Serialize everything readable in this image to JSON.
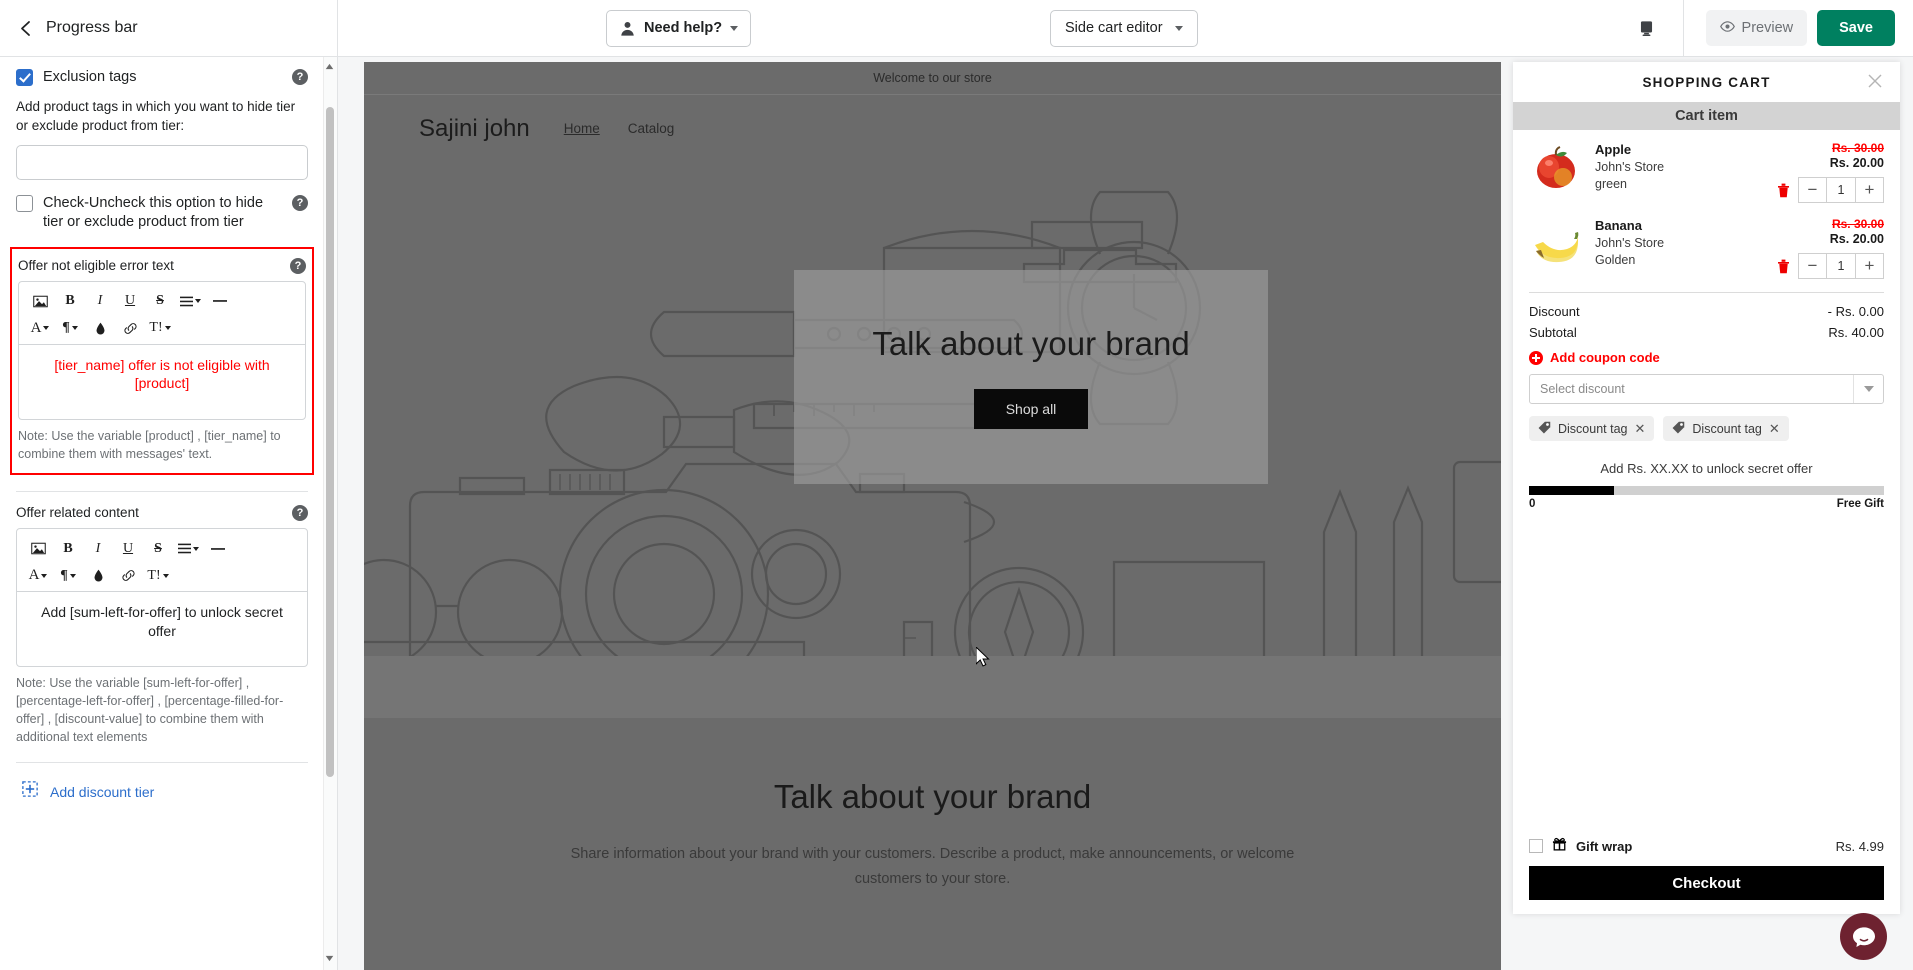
{
  "topbar": {
    "back_icon": "chevron-left-icon",
    "page_title": "Progress bar",
    "need_help_label": "Need help?",
    "need_help_icon": "person-icon",
    "editor_select_label": "Side cart editor",
    "device_icon": "desktop-icon",
    "preview_label": "Preview",
    "preview_icon": "eye-icon",
    "save_label": "Save"
  },
  "left_panel": {
    "exclusion_tags": {
      "label": "Exclusion tags",
      "checked": true,
      "help_icon": "help-icon",
      "description": "Add product tags in which you want to hide tier or exclude product from tier:",
      "input_value": "",
      "input_placeholder": ""
    },
    "hide_tier_checkbox": {
      "label": "Check-Uncheck this option to hide tier or exclude product from tier",
      "checked": false,
      "help_icon": "help-icon"
    },
    "error_text_section": {
      "title": "Offer not eligible error text",
      "help_icon": "help-icon",
      "content": "[tier_name] offer is not eligible with [product]",
      "note": "Note: Use the variable [product] , [tier_name] to combine them with messages' text.",
      "toolbar": [
        {
          "icon": "image-icon",
          "label": "☐"
        },
        {
          "icon": "bold-icon",
          "label": "B"
        },
        {
          "icon": "italic-icon",
          "label": "I"
        },
        {
          "icon": "underline-icon",
          "label": "U"
        },
        {
          "icon": "strikethrough-icon",
          "label": "S"
        },
        {
          "icon": "align-icon",
          "label": "≡"
        },
        {
          "icon": "horizontal-rule-icon",
          "label": "—"
        },
        {
          "icon": "font-color-icon",
          "label": "A"
        },
        {
          "icon": "paragraph-icon",
          "label": "¶"
        },
        {
          "icon": "highlight-icon",
          "label": "◆"
        },
        {
          "icon": "link-icon",
          "label": "⚭"
        },
        {
          "icon": "clear-format-icon",
          "label": "T!"
        }
      ]
    },
    "related_content_section": {
      "title": "Offer related content",
      "help_icon": "help-icon",
      "content": "Add [sum-left-for-offer] to unlock secret offer",
      "note": "Note: Use the variable [sum-left-for-offer] , [percentage-left-for-offer] , [percentage-filled-for-offer] , [discount-value] to combine them with additional text elements"
    },
    "add_tier": {
      "label": "Add discount tier",
      "icon": "add-square-icon"
    }
  },
  "store_preview": {
    "announcement": "Welcome to our store",
    "brand": "Sajini john",
    "nav": [
      {
        "label": "Home",
        "active": true
      },
      {
        "label": "Catalog",
        "active": false
      }
    ],
    "hero": {
      "title": "Talk about your brand",
      "button": "Shop all"
    },
    "rich_text": {
      "title": "Talk about your brand",
      "body": "Share information about your brand with your customers. Describe a product, make announcements, or welcome customers to your store."
    }
  },
  "cart": {
    "title": "SHOPPING CART",
    "close_icon": "close-icon",
    "section_label": "Cart item",
    "items": [
      {
        "name": "Apple",
        "store": "John's Store",
        "variant": "green",
        "price_old": "Rs. 30.00",
        "price_new": "Rs. 20.00",
        "qty": "1",
        "thumb": "apple-image",
        "delete_icon": "trash-icon"
      },
      {
        "name": "Banana",
        "store": "John's Store",
        "variant": "Golden",
        "price_old": "Rs. 30.00",
        "price_new": "Rs. 20.00",
        "qty": "1",
        "thumb": "banana-image",
        "delete_icon": "trash-icon"
      }
    ],
    "discount_label": "Discount",
    "discount_value": "- Rs. 0.00",
    "subtotal_label": "Subtotal",
    "subtotal_value": "Rs. 40.00",
    "coupon_label": "Add coupon code",
    "select_discount_placeholder": "Select discount",
    "tags": [
      {
        "label": "Discount tag"
      },
      {
        "label": "Discount tag"
      }
    ],
    "progress": {
      "text": "Add Rs. XX.XX to unlock secret offer",
      "start_label": "0",
      "end_label": "Free Gift",
      "percent": 24
    },
    "gift_wrap": {
      "label": "Gift wrap",
      "price": "Rs. 4.99",
      "icon": "gift-icon",
      "checked": false
    },
    "checkout_label": "Checkout",
    "chat_icon": "chat-bubble-icon"
  },
  "colors": {
    "accent_green": "#008060",
    "error_red": "#ff0000",
    "link_blue": "#2c6ecb",
    "checkbox_blue": "#2c6ecb"
  }
}
